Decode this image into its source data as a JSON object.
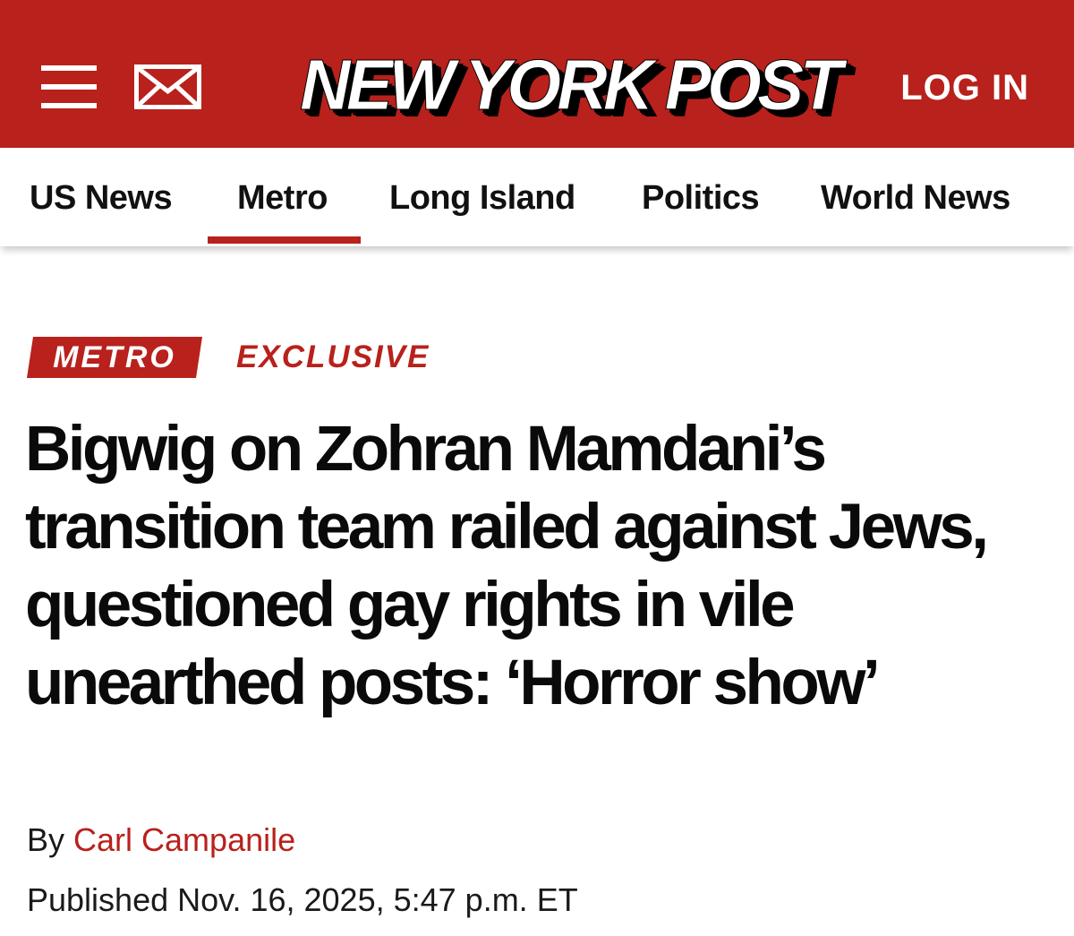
{
  "header": {
    "logo_text": "NEW YORK POST",
    "login_label": "LOG IN",
    "menu_icon": "hamburger-menu-icon",
    "mail_icon": "envelope-icon",
    "brand_red": "#b8211c"
  },
  "nav": {
    "items": [
      "US News",
      "Metro",
      "Long Island",
      "Politics",
      "World News"
    ],
    "active": "Metro"
  },
  "article": {
    "section_tag": "METRO",
    "exclusive_tag": "EXCLUSIVE",
    "headline": "Bigwig on Zohran Mamdani’s transition team railed against Jews, questioned gay rights in vile unearthed posts: ‘Horror show’",
    "byline_prefix": "By",
    "author": "Carl Campanile",
    "published": "Published Nov. 16, 2025, 5:47 p.m. ET"
  }
}
